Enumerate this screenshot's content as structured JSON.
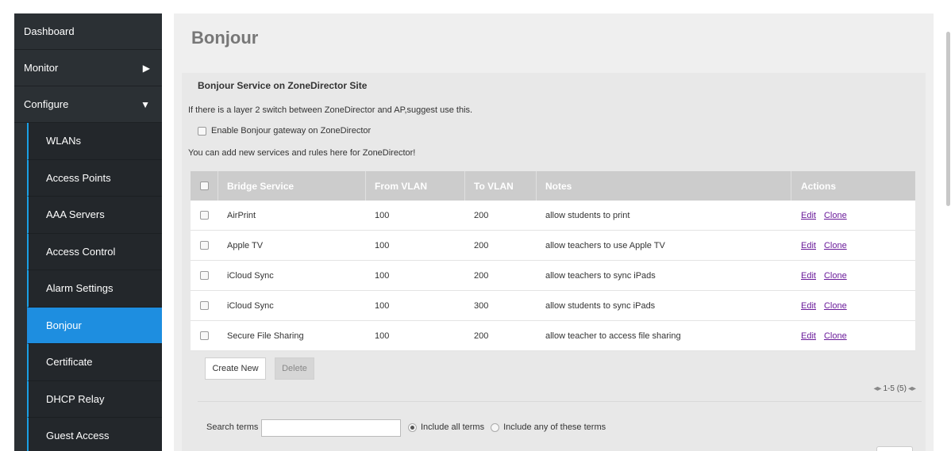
{
  "sidebar": {
    "top_items": [
      {
        "label": "Dashboard",
        "arrow": ""
      },
      {
        "label": "Monitor",
        "arrow": "▶"
      },
      {
        "label": "Configure",
        "arrow": "▼"
      }
    ],
    "sub_items": [
      {
        "label": "WLANs"
      },
      {
        "label": "Access Points"
      },
      {
        "label": "AAA Servers"
      },
      {
        "label": "Access Control"
      },
      {
        "label": "Alarm Settings"
      },
      {
        "label": "Bonjour"
      },
      {
        "label": "Certificate"
      },
      {
        "label": "DHCP Relay"
      },
      {
        "label": "Guest Access"
      }
    ],
    "active": "Bonjour",
    "accent_color": "#1e8ee0"
  },
  "page": {
    "title": "Bonjour"
  },
  "panel": {
    "title": "Bonjour Service on ZoneDirector Site",
    "note1": "If there is a layer 2 switch between ZoneDirector and AP,suggest use this.",
    "gateway_label": "Enable Bonjour gateway on ZoneDirector",
    "gateway_checked": false,
    "note2": "You can add new services and rules here for ZoneDirector!"
  },
  "table": {
    "columns": [
      "Bridge Service",
      "From VLAN",
      "To VLAN",
      "Notes",
      "Actions"
    ],
    "rows": [
      {
        "service": "AirPrint",
        "from": "100",
        "to": "200",
        "notes": "allow students to print",
        "edit": "Edit",
        "clone": "Clone"
      },
      {
        "service": "Apple TV",
        "from": "100",
        "to": "200",
        "notes": "allow teachers to use Apple TV",
        "edit": "Edit",
        "clone": "Clone"
      },
      {
        "service": "iCloud Sync",
        "from": "100",
        "to": "200",
        "notes": "allow teachers to sync iPads",
        "edit": "Edit",
        "clone": "Clone"
      },
      {
        "service": "iCloud Sync",
        "from": "100",
        "to": "300",
        "notes": "allow students to sync iPads",
        "edit": "Edit",
        "clone": "Clone"
      },
      {
        "service": "Secure File Sharing",
        "from": "100",
        "to": "200",
        "notes": "allow teacher to access file sharing",
        "edit": "Edit",
        "clone": "Clone"
      }
    ]
  },
  "buttons": {
    "create": "Create New",
    "delete": "Delete"
  },
  "pager": {
    "text": "1-5 (5)",
    "prev_icon": "prev-page-icon",
    "next_icon": "next-page-icon"
  },
  "search": {
    "label": "Search terms",
    "value": "",
    "placeholder": "",
    "option_all": "Include all terms",
    "option_any": "Include any of these terms",
    "selected": "all"
  }
}
